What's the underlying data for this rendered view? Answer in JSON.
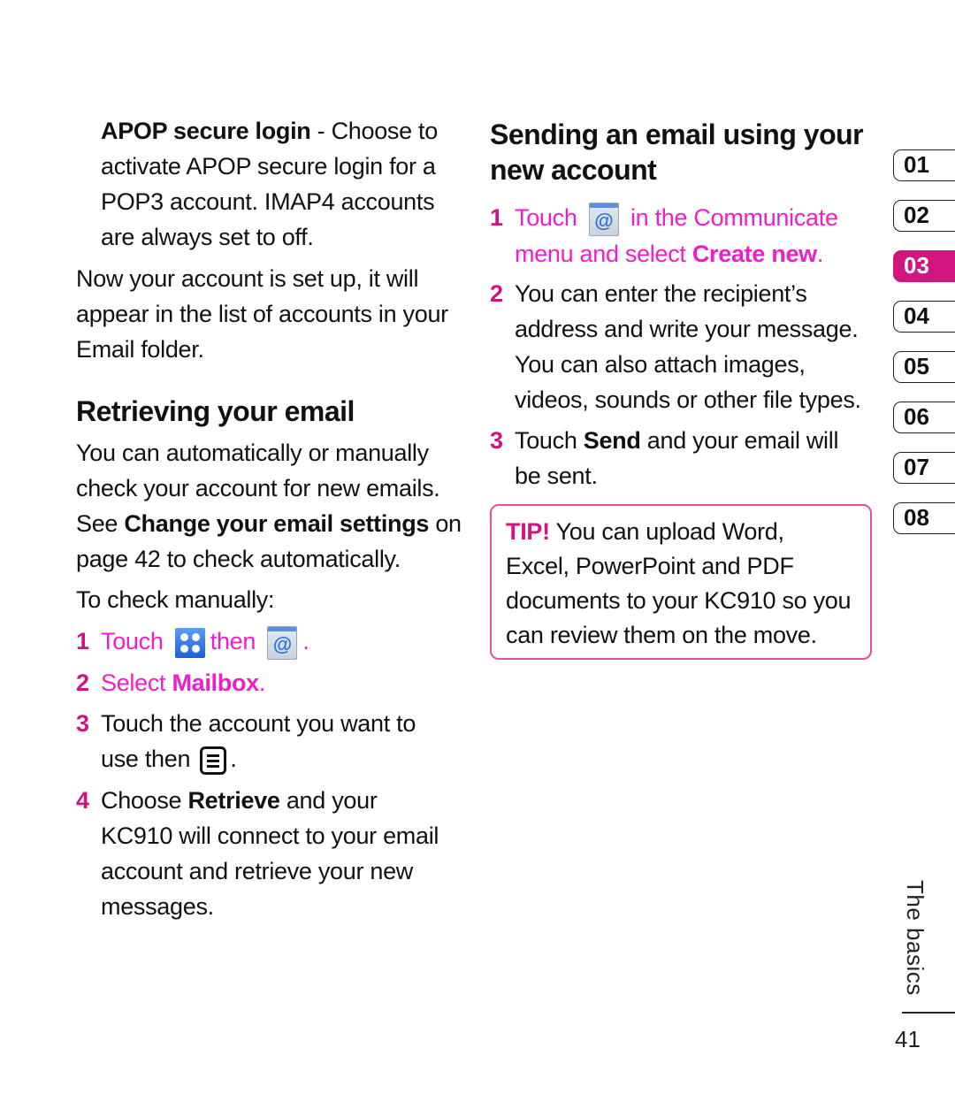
{
  "left_column": {
    "apop_term": "APOP secure login",
    "apop_desc_first": " - Choose to",
    "apop_lines": [
      "activate APOP secure login for a",
      "POP3 account. IMAP4 accounts",
      "are always set to off."
    ],
    "account_setup_lines": [
      "Now your account is set up, it will",
      "appear in the list of accounts in your",
      "Email folder."
    ],
    "retrieving_heading": "Retrieving your email",
    "retrieving_lines": [
      "You can automatically or manually",
      "check your account for new emails."
    ],
    "see_prefix": "See ",
    "see_bold": "Change your email settings",
    "see_suffix": " on",
    "see_line2": "page 42 to check automatically.",
    "to_check_manually": "To check manually:",
    "steps": [
      {
        "num": "1",
        "text_a": "Touch",
        "text_b": "then",
        "text_c": ".",
        "icon_a": "menu-grid-icon",
        "icon_b": "email-at-icon"
      },
      {
        "num": "2",
        "text_a": "Select ",
        "bold": "Mailbox",
        "text_c": "."
      },
      {
        "num": "3",
        "line1": "Touch the account you want to",
        "line2": "use then",
        "line2_end": ".",
        "icon": "options-list-icon"
      },
      {
        "num": "4",
        "text_a": "Choose ",
        "bold": "Retrieve",
        "text_b": " and your",
        "lines": [
          "KC910 will connect to your email",
          "account and retrieve your new",
          "messages."
        ]
      }
    ]
  },
  "right_column": {
    "heading_lines": [
      "Sending an email using your",
      "new account"
    ],
    "steps": [
      {
        "num": "1",
        "text_a": "Touch",
        "text_b": "in the Communicate",
        "line2": "menu and select ",
        "bold": "Create new",
        "end": ".",
        "icon": "email-at-icon"
      },
      {
        "num": "2",
        "lines": [
          "You can enter the recipient’s",
          "address and write your message.",
          "You can also attach images,",
          "videos, sounds or other file types."
        ]
      },
      {
        "num": "3",
        "text_a": "Touch ",
        "bold": "Send",
        "text_b": " and your email will",
        "line2": "be sent."
      }
    ],
    "tip": {
      "label": "TIP!",
      "first": " You can upload Word,",
      "lines": [
        "Excel, PowerPoint and PDF",
        "documents to your KC910 so you",
        "can review them on the move."
      ]
    }
  },
  "chapter_tabs": [
    {
      "label": "01",
      "active": false
    },
    {
      "label": "02",
      "active": false
    },
    {
      "label": "03",
      "active": true
    },
    {
      "label": "04",
      "active": false
    },
    {
      "label": "05",
      "active": false
    },
    {
      "label": "06",
      "active": false
    },
    {
      "label": "07",
      "active": false
    },
    {
      "label": "08",
      "active": false
    }
  ],
  "section_label": "The basics",
  "page_number": "41",
  "colors": {
    "accent_pink": "#d0157f",
    "link_magenta": "#f01ec8",
    "tip_border": "#e0509f"
  }
}
